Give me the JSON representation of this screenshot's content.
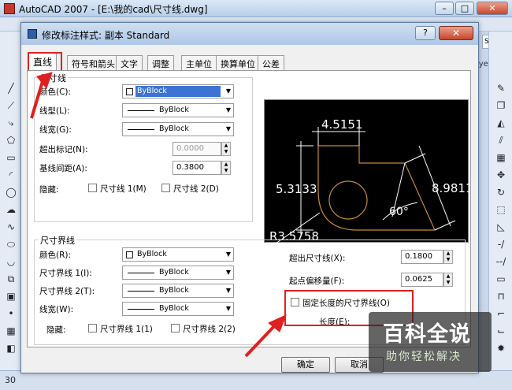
{
  "app": {
    "title": "AutoCAD 2007 - [E:\\我的cad\\尺寸线.dwg]",
    "right_combo": "Stand",
    "layer_label": "Layer",
    "status_text": "30"
  },
  "dialog": {
    "title": "修改标注样式: 副本 Standard",
    "help": "?",
    "close": "✕",
    "tabs": [
      "直线",
      "符号和箭头",
      "文字",
      "调整",
      "主单位",
      "换算单位",
      "公差"
    ],
    "active_tab": "直线"
  },
  "dimline": {
    "group_title": "尺寸线",
    "color_label": "颜色(C):",
    "color_value": "ByBlock",
    "linetype_label": "线型(L):",
    "linetype_value": "ByBlock",
    "lineweight_label": "线宽(G):",
    "lineweight_value": "ByBlock",
    "extend_label": "超出标记(N):",
    "extend_value": "0.0000",
    "spacing_label": "基线间距(A):",
    "spacing_value": "0.3800",
    "suppress_label": "隐藏:",
    "suppress1": "尺寸线 1(M)",
    "suppress2": "尺寸线 2(D)"
  },
  "extline": {
    "group_title": "尺寸界线",
    "color_label": "颜色(R):",
    "color_value": "ByBlock",
    "linetype1_label": "尺寸界线 1(I):",
    "linetype1_value": "ByBlock",
    "linetype2_label": "尺寸界线 2(T):",
    "linetype2_value": "ByBlock",
    "lineweight_label": "线宽(W):",
    "lineweight_value": "ByBlock",
    "suppress_label": "隐藏:",
    "suppress1": "尺寸界线 1(1)",
    "suppress2": "尺寸界线 2(2)",
    "beyond_label": "超出尺寸线(X):",
    "beyond_value": "0.1800",
    "offset_label": "起点偏移量(F):",
    "offset_value": "0.0625",
    "fixed_label": "固定长度的尺寸界线(O)",
    "length_label": "长度(E):"
  },
  "preview": {
    "dim_top": "4.5151",
    "dim_left": "5.3133",
    "dim_right": "8.9811",
    "angle": "60°",
    "radius": "R3.5758"
  },
  "buttons": {
    "ok": "确定",
    "cancel": "取消"
  },
  "watermark": {
    "main": "百科全说",
    "sub": "助你轻松解决"
  },
  "colors": {
    "highlight_red": "#e02020",
    "preview_line": "#c58a3a",
    "preview_bg": "#000000"
  }
}
